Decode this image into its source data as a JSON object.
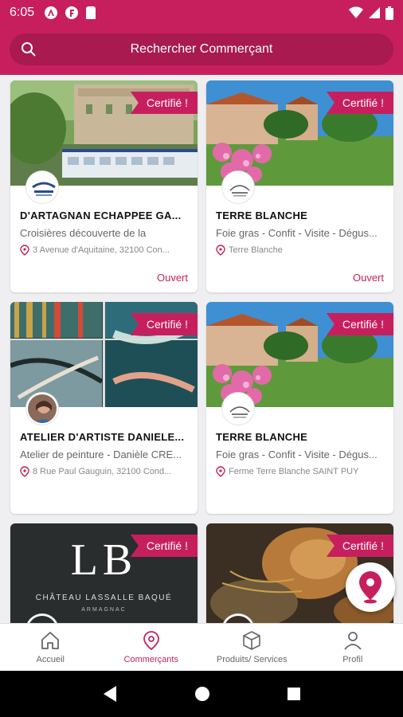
{
  "status_bar": {
    "time": "6:05"
  },
  "search": {
    "placeholder_text": "Rechercher Commerçant"
  },
  "cards": [
    {
      "badge": "Certifié !",
      "title": "D'ARTAGNAN ECHAPPEE GA...",
      "description": "Croisières découverte de la",
      "address": "3 Avenue d'Aquitaine, 32100 Con...",
      "status": "Ouvert"
    },
    {
      "badge": "Certifié !",
      "title": "TERRE BLANCHE",
      "description": "Foie gras - Confit - Visite - Dégus...",
      "address": "Terre Blanche",
      "status": "Ouvert"
    },
    {
      "badge": "Certifié !",
      "title": "ATELIER D'ARTISTE DANIELE...",
      "description": "Atelier de peinture - Danièle CRE...",
      "address": "8 Rue Paul Gauguin, 32100 Cond...",
      "status": ""
    },
    {
      "badge": "Certifié !",
      "title": "TERRE BLANCHE",
      "description": "Foie gras - Confit - Visite - Dégus...",
      "address": "Ferme Terre Blanche SAINT PUY",
      "status": ""
    },
    {
      "badge": "Certifié !",
      "title": "",
      "description": "",
      "address": "",
      "status": "",
      "logo_text": "LB",
      "logo_sub1": "CHÂTEAU LASSALLE BAQUÉ",
      "logo_sub2": "ARMAGNAC"
    },
    {
      "badge": "Certifié !",
      "title": "",
      "description": "",
      "address": "",
      "status": ""
    }
  ],
  "bottom_nav": [
    {
      "label": "Accueil",
      "icon": "home-icon"
    },
    {
      "label": "Commerçants",
      "icon": "location-pin-icon",
      "active": true
    },
    {
      "label": "Produits/ Services",
      "icon": "box-icon"
    },
    {
      "label": "Profil",
      "icon": "person-icon"
    }
  ],
  "colors": {
    "brand": "#c71f5e",
    "muted_text": "#666666"
  }
}
